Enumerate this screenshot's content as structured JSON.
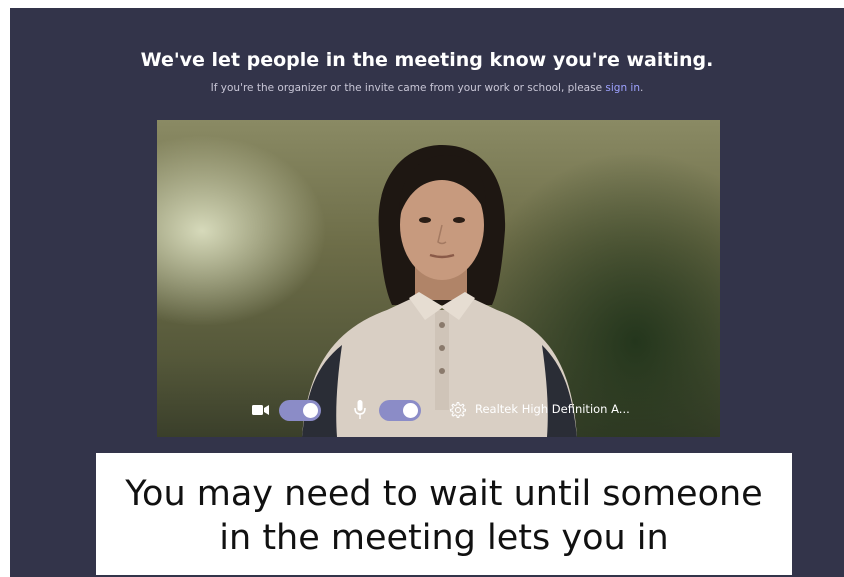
{
  "header": {
    "title": "We've let people in the meeting know you're waiting.",
    "subtitle_prefix": "If you're the organizer or the invite came from your work or school, please ",
    "signin_link": "sign in",
    "subtitle_suffix": "."
  },
  "video_controls": {
    "camera_icon": "video-camera-icon",
    "camera_toggle_on": true,
    "mic_icon": "microphone-icon",
    "mic_toggle_on": true,
    "settings_icon": "gear-icon",
    "audio_device": "Realtek High Definition A..."
  },
  "caption": {
    "line1": "You may need to wait until someone",
    "line2": "in the meeting lets you in"
  },
  "colors": {
    "background": "#33344a",
    "toggle": "#8b8cc7",
    "link": "#9ea2ff"
  }
}
